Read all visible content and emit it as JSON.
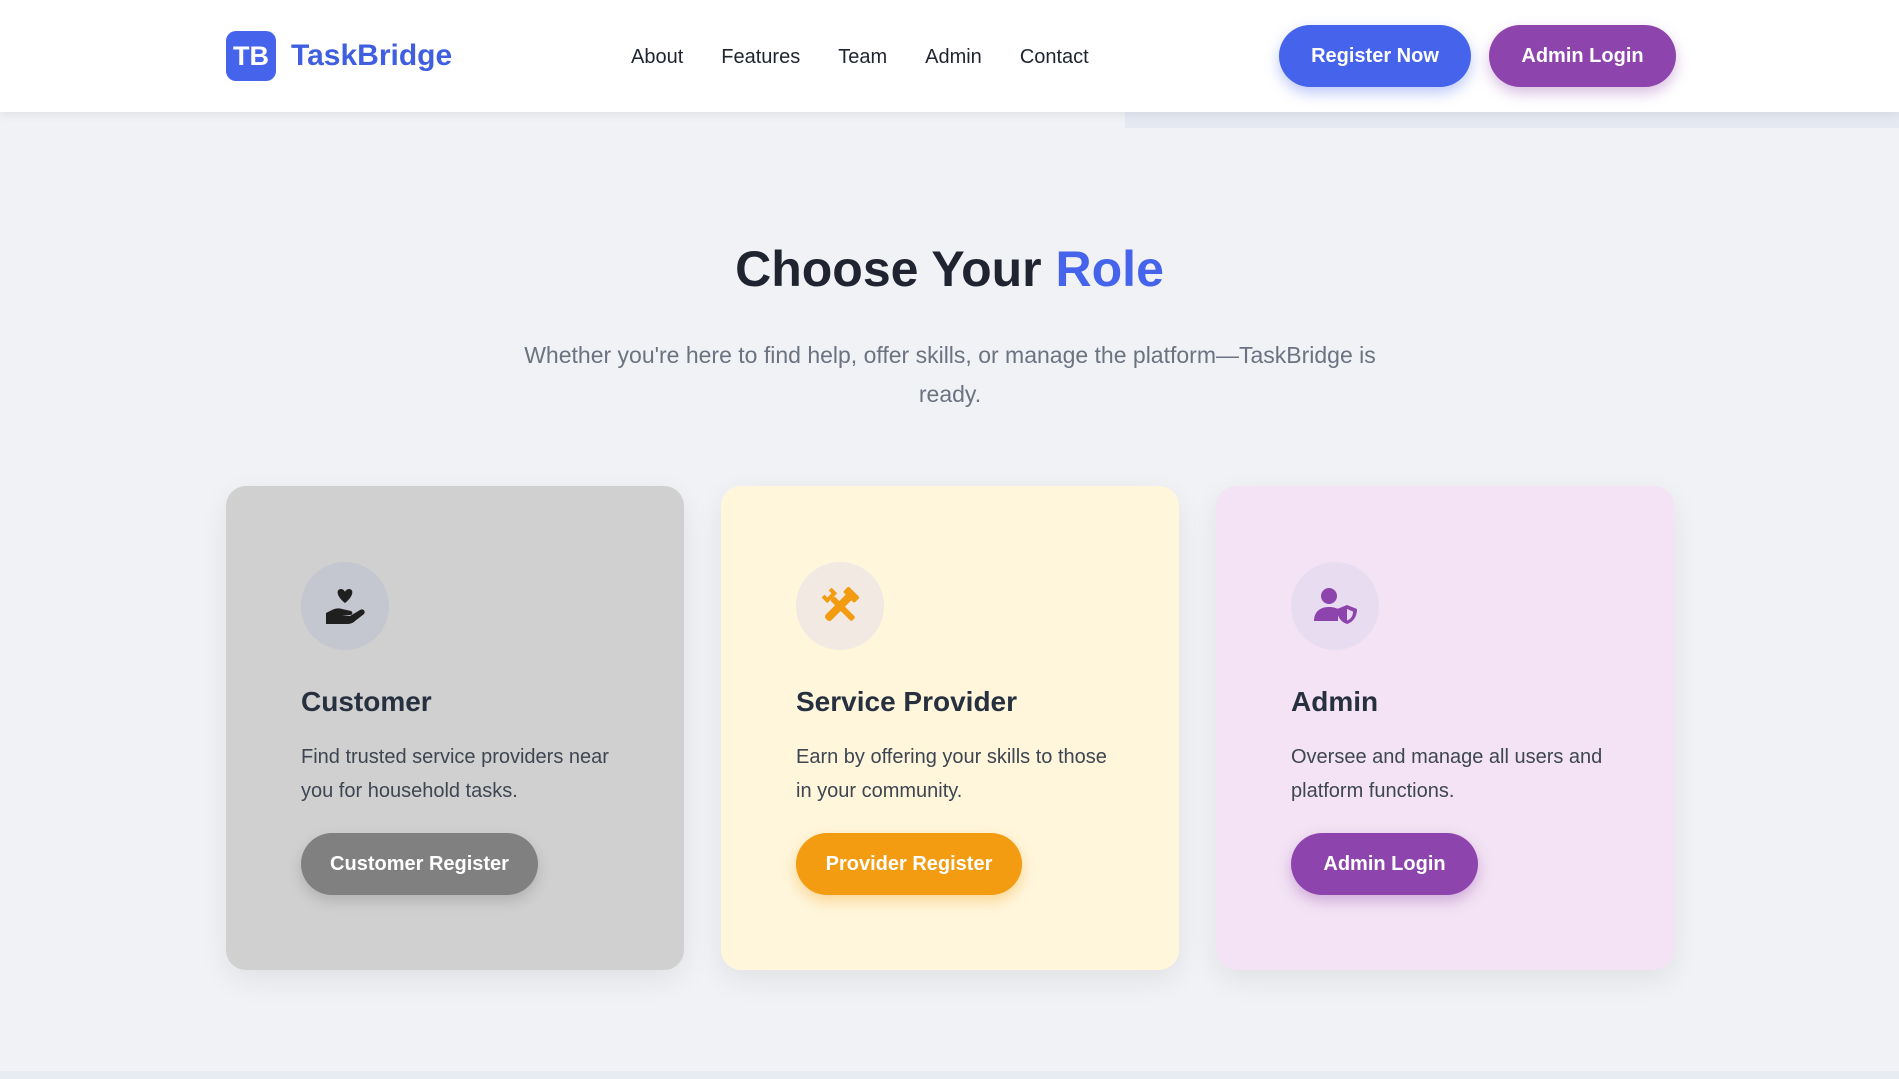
{
  "header": {
    "logo_badge": "TB",
    "logo_text": "TaskBridge",
    "nav": [
      "About",
      "Features",
      "Team",
      "Admin",
      "Contact"
    ],
    "register_button": "Register Now",
    "admin_button": "Admin Login"
  },
  "hero": {
    "title_main": "Choose Your",
    "title_accent": "Role",
    "subtitle": "Whether you're here to find help, offer skills, or manage the platform—TaskBridge is ready."
  },
  "cards": [
    {
      "icon": "hand-holding-heart-icon",
      "title": "Customer",
      "description": "Find trusted service providers near you for household tasks.",
      "button": "Customer Register"
    },
    {
      "icon": "tools-icon",
      "title": "Service Provider",
      "description": "Earn by offering your skills to those in your community.",
      "button": "Provider Register"
    },
    {
      "icon": "user-shield-icon",
      "title": "Admin",
      "description": "Oversee and manage all users and platform functions.",
      "button": "Admin Login"
    }
  ],
  "colors": {
    "primary": "#4563eb",
    "admin_purple": "#8e44ad",
    "provider_orange": "#f39c12",
    "customer_gray": "#808080"
  }
}
